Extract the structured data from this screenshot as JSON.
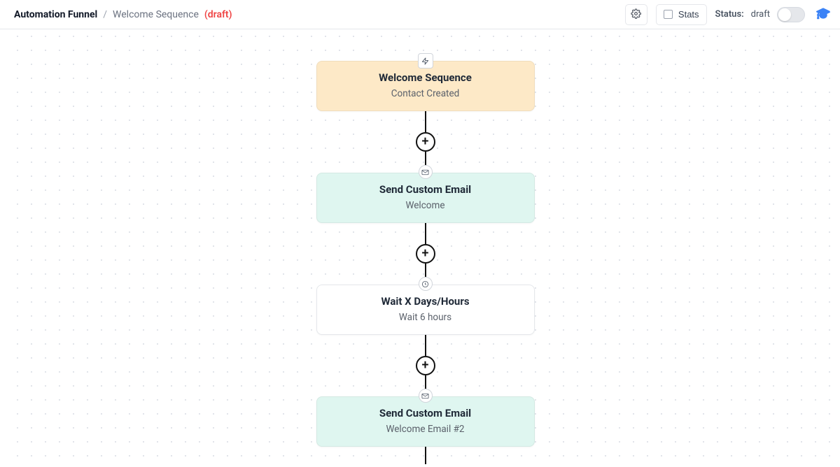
{
  "breadcrumb": {
    "root": "Automation Funnel",
    "sep": "/",
    "name": "Welcome Sequence",
    "draft": "(draft)"
  },
  "topbar": {
    "stats_label": "Stats",
    "status_prefix": "Status:",
    "status_value": "draft"
  },
  "flow": {
    "nodes": [
      {
        "type": "trigger",
        "title": "Welcome Sequence",
        "subtitle": "Contact Created"
      },
      {
        "type": "email",
        "title": "Send Custom Email",
        "subtitle": "Welcome"
      },
      {
        "type": "wait",
        "title": "Wait X Days/Hours",
        "subtitle": "Wait 6 hours"
      },
      {
        "type": "email",
        "title": "Send Custom Email",
        "subtitle": "Welcome Email #2"
      }
    ]
  }
}
